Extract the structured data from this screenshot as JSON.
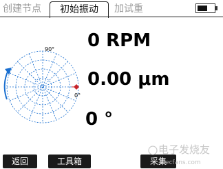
{
  "tabs": [
    {
      "label": "创建节点",
      "active": false
    },
    {
      "label": "初始振动",
      "active": true
    },
    {
      "label": "加试重",
      "active": false
    }
  ],
  "battery": {
    "level": 0.6
  },
  "polar_plot": {
    "angle_label_top": "90°",
    "angle_label_right": "0°"
  },
  "readouts": {
    "speed": "0 RPM",
    "amplitude": "0.00 μm",
    "phase": "0 °"
  },
  "buttons": {
    "back": "返回",
    "toolbox": "工具箱",
    "collect": "采集"
  },
  "watermark": {
    "text": "电子发烧友",
    "subtext": "elecfans.com"
  },
  "colors": {
    "polar_grid": "#1a6fd0",
    "marker": "#c8242a",
    "button_bg": "#1a1a1a"
  }
}
